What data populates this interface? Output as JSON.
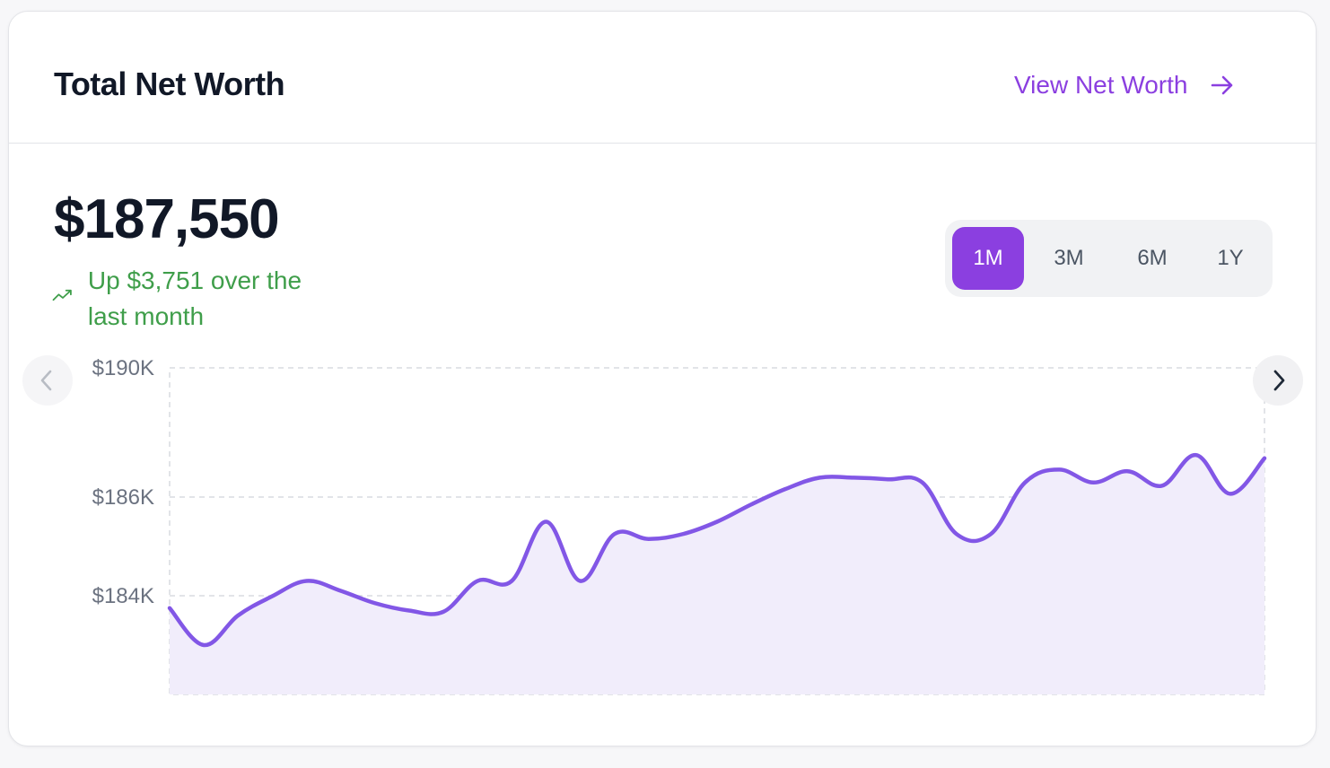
{
  "card": {
    "title": "Total Net Worth",
    "view_link_label": "View Net Worth",
    "view_link_icon": "arrow-right-icon"
  },
  "summary": {
    "amount": "$187,550",
    "change_text": "Up $3,751 over the last month",
    "change_icon": "trending-up-icon",
    "change_color": "#3f9e4a"
  },
  "range": {
    "options": [
      "1M",
      "3M",
      "6M",
      "1Y"
    ],
    "selected": "1M",
    "accent": "#8b3fe0"
  },
  "navigation": {
    "prev_icon": "chevron-left-icon",
    "next_icon": "chevron-right-icon"
  },
  "chart_data": {
    "type": "area",
    "title": "",
    "xlabel": "",
    "ylabel": "",
    "y_tick_labels": [
      "$190K",
      "$186K",
      "$184K"
    ],
    "y_tick_values": [
      190000,
      186000,
      184000
    ],
    "ylim": [
      182000,
      190000
    ],
    "grid": true,
    "line_color": "#8257e6",
    "fill_color": "#f1edfb",
    "series": [
      {
        "values": [
          183750,
          183000,
          183600,
          183990,
          184300,
          184100,
          183850,
          183700,
          183675,
          184300,
          184300,
          185500,
          184300,
          185250,
          185150,
          185250,
          185500,
          185850,
          186250,
          186600,
          186600,
          186550,
          186450,
          185250,
          185250,
          186450,
          186850,
          186450,
          186800,
          186350,
          187300,
          186100,
          187200
        ]
      }
    ]
  }
}
